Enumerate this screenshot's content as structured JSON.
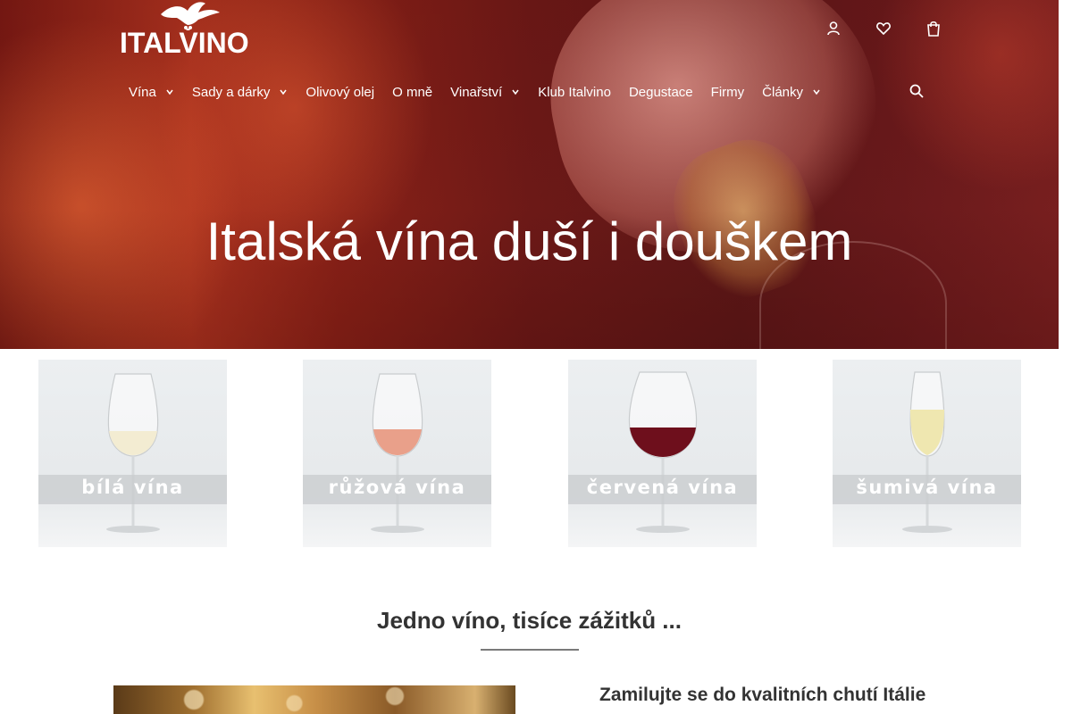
{
  "header": {
    "logo_text": "ITALVINO",
    "top_icons": [
      "user-icon",
      "heart-icon",
      "cart-icon"
    ],
    "search_icon": "search-icon"
  },
  "nav": {
    "items": [
      {
        "label": "Vína",
        "has_dropdown": true
      },
      {
        "label": "Sady a dárky",
        "has_dropdown": true
      },
      {
        "label": "Olivový olej",
        "has_dropdown": false
      },
      {
        "label": "O mně",
        "has_dropdown": false
      },
      {
        "label": "Vinařství",
        "has_dropdown": true
      },
      {
        "label": "Klub Italvino",
        "has_dropdown": false
      },
      {
        "label": "Degustace",
        "has_dropdown": false
      },
      {
        "label": "Firmy",
        "has_dropdown": false
      },
      {
        "label": "Články",
        "has_dropdown": true
      }
    ]
  },
  "hero": {
    "title": "Italská vína duší i douškem"
  },
  "categories": [
    {
      "label": "bílá vína",
      "wine_color": "#f3ecd2"
    },
    {
      "label": "růžová vína",
      "wine_color": "#e9a08a"
    },
    {
      "label": "červená vína",
      "wine_color": "#6e0f1c"
    },
    {
      "label": "šumivá vína",
      "wine_color": "#efe7b0"
    }
  ],
  "intro": {
    "title": "Jedno víno, tisíce zážitků ...",
    "feature_heading": "Zamilujte se do kvalitních chutí Itálie"
  },
  "colors": {
    "hero_red": "#8c2218",
    "text_white": "#ffffff",
    "text_dark": "#333333",
    "divider": "#7a7a7a"
  }
}
